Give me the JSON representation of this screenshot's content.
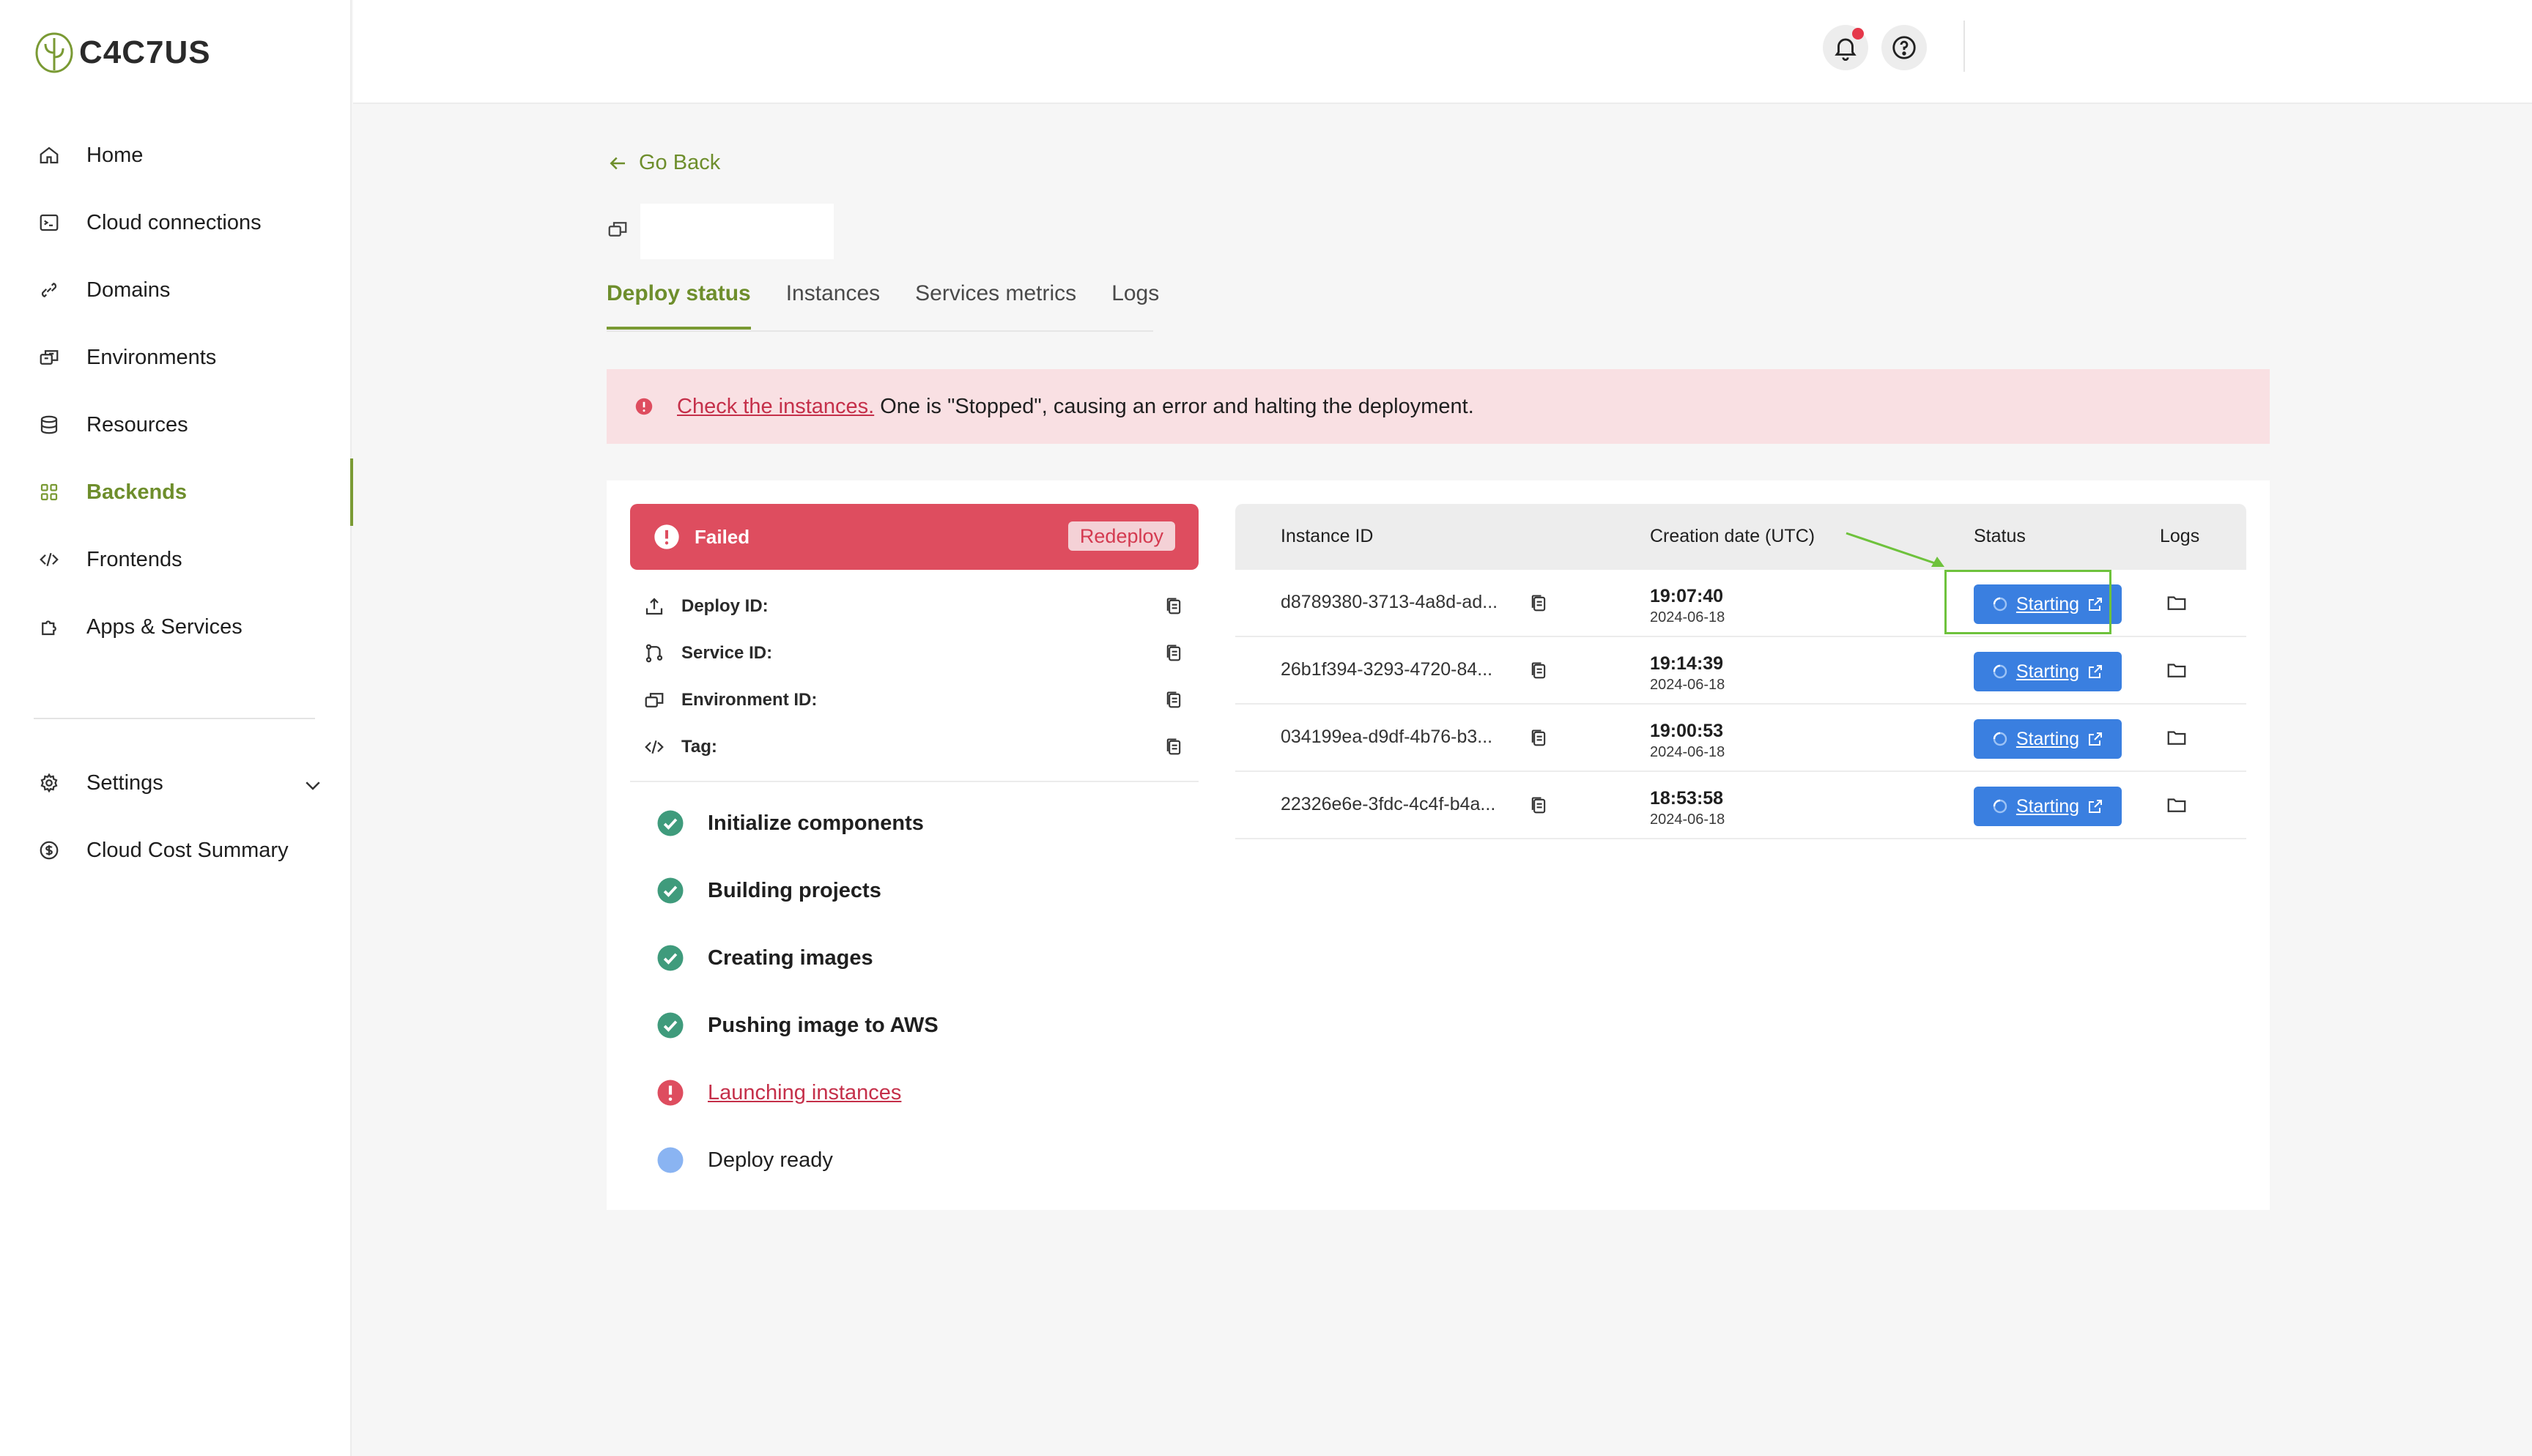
{
  "app": {
    "logo_text": "C4C7US"
  },
  "sidebar": {
    "items": [
      {
        "label": "Home",
        "icon": "home-icon"
      },
      {
        "label": "Cloud connections",
        "icon": "terminal-icon"
      },
      {
        "label": "Domains",
        "icon": "link-icon"
      },
      {
        "label": "Environments",
        "icon": "environment-icon"
      },
      {
        "label": "Resources",
        "icon": "database-icon"
      },
      {
        "label": "Backends",
        "icon": "grid-icon",
        "active": true
      },
      {
        "label": "Frontends",
        "icon": "code-icon"
      },
      {
        "label": "Apps & Services",
        "icon": "puzzle-icon"
      }
    ],
    "settings_label": "Settings",
    "cost_label": "Cloud Cost Summary"
  },
  "header": {
    "notifications_icon": "bell-icon",
    "help_icon": "help-icon"
  },
  "main": {
    "go_back": "Go Back",
    "tabs": [
      {
        "label": "Deploy status",
        "active": true
      },
      {
        "label": "Instances"
      },
      {
        "label": "Services metrics"
      },
      {
        "label": "Logs"
      }
    ],
    "alert": {
      "link": "Check the instances.",
      "text": "One is \"Stopped\", causing an error and halting the deployment."
    },
    "deploy": {
      "status": "Failed",
      "redeploy": "Redeploy",
      "fields": [
        {
          "label": "Deploy ID:",
          "icon": "upload-icon"
        },
        {
          "label": "Service ID:",
          "icon": "git-branch-icon"
        },
        {
          "label": "Environment ID:",
          "icon": "environment-icon"
        },
        {
          "label": "Tag:",
          "icon": "code-icon"
        }
      ],
      "steps": [
        {
          "label": "Initialize components",
          "state": "done"
        },
        {
          "label": "Building projects",
          "state": "done"
        },
        {
          "label": "Creating images",
          "state": "done"
        },
        {
          "label": "Pushing image to AWS",
          "state": "done"
        },
        {
          "label": "Launching instances",
          "state": "error"
        },
        {
          "label": "Deploy ready",
          "state": "pending"
        }
      ]
    },
    "instances": {
      "headers": {
        "id": "Instance ID",
        "date": "Creation date (UTC)",
        "status": "Status",
        "logs": "Logs"
      },
      "rows": [
        {
          "id": "d8789380-3713-4a8d-ad...",
          "time": "19:07:40",
          "date": "2024-06-18",
          "status": "Starting"
        },
        {
          "id": "26b1f394-3293-4720-84...",
          "time": "19:14:39",
          "date": "2024-06-18",
          "status": "Starting"
        },
        {
          "id": "034199ea-d9df-4b76-b3...",
          "time": "19:00:53",
          "date": "2024-06-18",
          "status": "Starting"
        },
        {
          "id": "22326e6e-3fdc-4c4f-b4a...",
          "time": "18:53:58",
          "date": "2024-06-18",
          "status": "Starting"
        }
      ]
    }
  },
  "colors": {
    "accent": "#7a9a34",
    "danger": "#de4d5f",
    "primary": "#3a7fe0",
    "success": "#3f9b7c"
  }
}
